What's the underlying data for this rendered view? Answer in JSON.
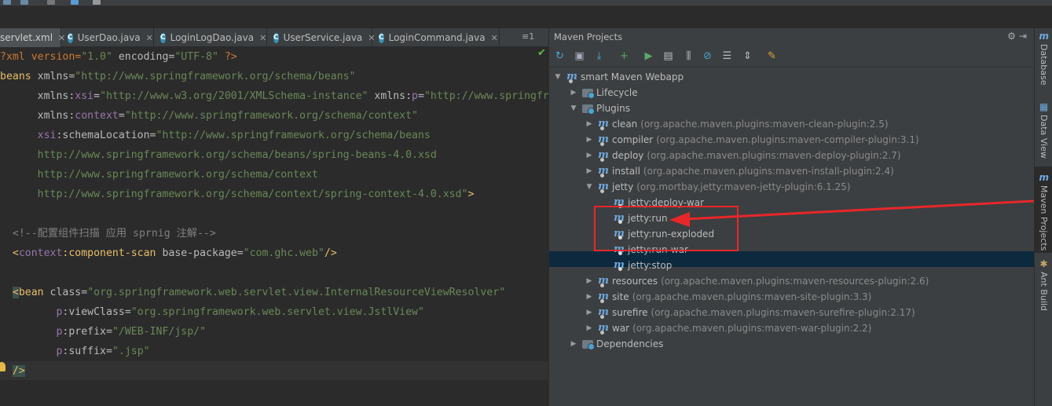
{
  "tabs": [
    {
      "label": "servlet.xml",
      "active": true,
      "icon": "xml-icon"
    },
    {
      "label": "UserDao.java",
      "active": false,
      "icon": "class-icon"
    },
    {
      "label": "LoginLogDao.java",
      "active": false,
      "icon": "class-icon"
    },
    {
      "label": "UserService.java",
      "active": false,
      "icon": "class-icon"
    },
    {
      "label": "LoginCommand.java",
      "active": false,
      "icon": "class-icon"
    }
  ],
  "tabs_more": "≡1",
  "code": {
    "l1": {
      "pre": "?xml version=",
      "v1": "\"1.0\"",
      "mid": " encoding=",
      "v2": "\"UTF-8\"",
      "end": " ?>"
    },
    "l2": {
      "tag": "beans",
      "attr": " xmlns=",
      "val": "\"http://www.springframework.org/schema/beans\""
    },
    "l3": {
      "ind": "      ",
      "ns1": "xmlns:",
      "ns1b": "xsi",
      "eq1": "=",
      "val1": "\"http://www.w3.org/2001/XMLSchema-instance\"",
      "ns2": " xmlns:",
      "ns2b": "p",
      "eq2": "=",
      "val2": "\"http://www.springfr"
    },
    "l4": {
      "ind": "      ",
      "ns": "xmlns:",
      "nsb": "context",
      "eq": "=",
      "val": "\"http://www.springframework.org/schema/context\""
    },
    "l5": {
      "ind": "      ",
      "nsb": "xsi",
      "ns": ":schemaLocation=",
      "val": "\"http://www.springframework.org/schema/beans"
    },
    "l6": "      http://www.springframework.org/schema/beans/spring-beans-4.0.xsd",
    "l7": "      http://www.springframework.org/schema/context",
    "l8": {
      "val": "      http://www.springframework.org/schema/context/spring-context-4.0.xsd\"",
      "end": ">"
    },
    "l10": "  <!--配置组件扫描 应用 sprnig 注解-->",
    "l11": {
      "ind": "  <",
      "nsb": "context",
      "tag": ":component-scan",
      "attr": " base-package=",
      "val": "\"com.ghc.web\"",
      "end": "/>"
    },
    "l13": {
      "ind": "  ",
      "lt": "<",
      "tag": "bean",
      "attr": " class=",
      "val": "\"org.springframework.web.servlet.view.InternalResourceViewResolver\""
    },
    "l14": {
      "ind": "         ",
      "nsb": "p",
      "attr": ":viewClass=",
      "val": "\"org.springframework.web.servlet.view.JstlView\""
    },
    "l15": {
      "ind": "         ",
      "nsb": "p",
      "attr": ":prefix=",
      "val": "\"/WEB-INF/jsp/\""
    },
    "l16": {
      "ind": "         ",
      "nsb": "p",
      "attr": ":suffix=",
      "val": "\".jsp\""
    },
    "l17": {
      "ind": "  ",
      "end": "/>"
    }
  },
  "maven": {
    "title": "Maven Projects",
    "tree": {
      "root": "smart Maven Webapp",
      "lifecycle": "Lifecycle",
      "plugins": "Plugins",
      "plugin_items": [
        {
          "name": "clean",
          "desc": "(org.apache.maven.plugins:maven-clean-plugin:2.5)"
        },
        {
          "name": "compiler",
          "desc": "(org.apache.maven.plugins:maven-compiler-plugin:3.1)"
        },
        {
          "name": "deploy",
          "desc": "(org.apache.maven.plugins:maven-deploy-plugin:2.7)"
        },
        {
          "name": "install",
          "desc": "(org.apache.maven.plugins:maven-install-plugin:2.4)"
        },
        {
          "name": "jetty",
          "desc": "(org.mortbay.jetty:maven-jetty-plugin:6.1.25)"
        }
      ],
      "jetty_goals": [
        "jetty:deploy-war",
        "jetty:run",
        "jetty:run-exploded",
        "jetty:run-war",
        "jetty:stop"
      ],
      "plugin_items2": [
        {
          "name": "resources",
          "desc": "(org.apache.maven.plugins:maven-resources-plugin:2.6)"
        },
        {
          "name": "site",
          "desc": "(org.apache.maven.plugins:maven-site-plugin:3.3)"
        },
        {
          "name": "surefire",
          "desc": "(org.apache.maven.plugins:maven-surefire-plugin:2.17)"
        },
        {
          "name": "war",
          "desc": "(org.apache.maven.plugins:maven-war-plugin:2.2)"
        }
      ],
      "dependencies": "Dependencies"
    }
  },
  "sidebar": [
    "Database",
    "Data View",
    "Maven Projects",
    "Ant Build"
  ],
  "colors": {
    "highlight_box": "#e8272a",
    "selection": "#0d293e",
    "accent": "#6fa8dc"
  }
}
